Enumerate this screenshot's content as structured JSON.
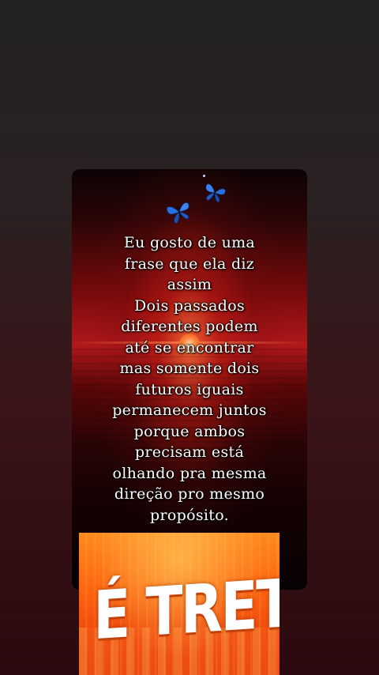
{
  "quote": {
    "lines": [
      "Eu gosto de uma",
      "frase que ela diz",
      "assim",
      "Dois passados",
      "diferentes podem",
      "até se encontrar",
      "mas somente dois",
      "futuros iguais",
      "permanecem juntos",
      "porque ambos",
      "precisam está",
      "olhando pra mesma",
      "direção pro mesmo",
      "propósito."
    ]
  },
  "sticker": {
    "text": "É TRETA!"
  },
  "icons": {
    "butterfly_1": "butterfly-icon",
    "butterfly_2": "butterfly-icon"
  },
  "colors": {
    "butterfly": "#2a6fe0",
    "sticker_orange": "#ff6a12",
    "text": "#ffffff"
  }
}
